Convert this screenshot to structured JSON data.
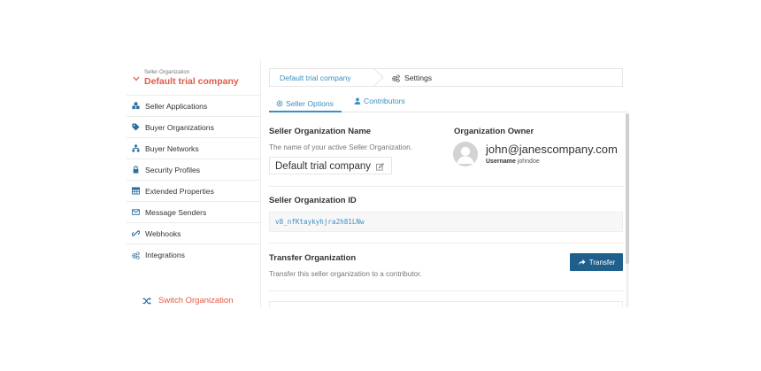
{
  "sidebar": {
    "org_small_label": "Seller Organization",
    "org_name": "Default trial company",
    "items": [
      {
        "label": "Seller Applications",
        "icon": "cubes-icon"
      },
      {
        "label": "Buyer Organizations",
        "icon": "tag-icon"
      },
      {
        "label": "Buyer Networks",
        "icon": "sitemap-icon"
      },
      {
        "label": "Security Profiles",
        "icon": "lock-icon"
      },
      {
        "label": "Extended Properties",
        "icon": "table-icon"
      },
      {
        "label": "Message Senders",
        "icon": "envelope-icon"
      },
      {
        "label": "Webhooks",
        "icon": "link-icon"
      },
      {
        "label": "Integrations",
        "icon": "cogs-icon"
      }
    ],
    "switch_label": "Switch Organization"
  },
  "breadcrumb": {
    "org": "Default trial company",
    "current": "Settings"
  },
  "tabs": [
    {
      "label": "Seller Options",
      "icon": "gear-icon"
    },
    {
      "label": "Contributors",
      "icon": "user-icon"
    }
  ],
  "name_section": {
    "title": "Seller Organization Name",
    "help": "The name of your active Seller Organization.",
    "value": "Default trial company"
  },
  "owner_section": {
    "title": "Organization Owner",
    "email": "john@janescompany.com",
    "username_label": "Username",
    "username": "johndoe"
  },
  "id_section": {
    "title": "Seller Organization ID",
    "value": "v8_nfKtaykyhjra2h81LNw"
  },
  "transfer_section": {
    "title": "Transfer Organization",
    "help": "Transfer this seller organization to a contributor.",
    "button_label": "Transfer"
  },
  "colors": {
    "accent_red": "#e05a47",
    "link_blue": "#3a8fc4",
    "button_blue": "#1f5f8b"
  }
}
